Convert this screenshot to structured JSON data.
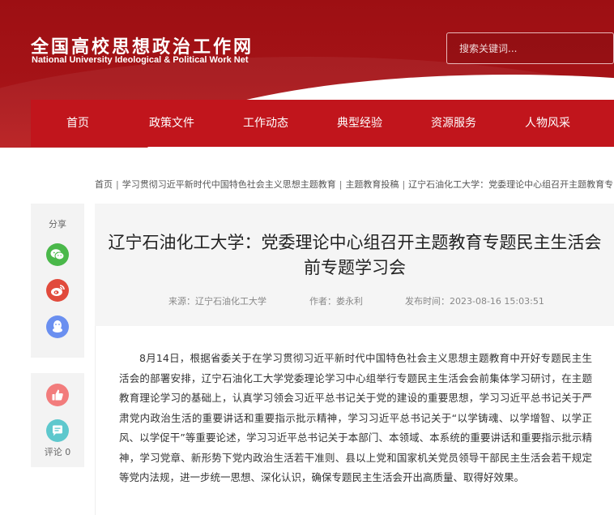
{
  "site": {
    "logo_cn": "全国高校思想政治工作网",
    "logo_en": "National University Ideological & Political Work Net"
  },
  "search": {
    "placeholder": "搜索关键词..."
  },
  "nav": {
    "items": [
      "首页",
      "政策文件",
      "工作动态",
      "典型经验",
      "资源服务",
      "人物风采"
    ]
  },
  "breadcrumb": {
    "items": [
      "首页",
      "学习贯彻习近平新时代中国特色社会主义思想主题教育",
      "主题教育投稿",
      "辽宁石油化工大学：党委理论中心组召开主题教育专"
    ]
  },
  "share": {
    "title": "分享",
    "icons": [
      "wechat-icon",
      "weibo-icon",
      "qq-icon"
    ]
  },
  "actions": {
    "comment_label": "评论 0"
  },
  "article": {
    "title": "辽宁石油化工大学：党委理论中心组召开主题教育专题民主生活会前专题学习会",
    "source": "来源：辽宁石油化工大学",
    "author": "作者：娄永利",
    "time": "发布时间：2023-08-16 15:03:51",
    "paragraph": "8月14日，根据省委关于在学习贯彻习近平新时代中国特色社会主义思想主题教育中开好专题民主生活会的部署安排，辽宁石油化工大学党委理论学习中心组举行专题民主生活会会前集体学习研讨，在主题教育理论学习的基础上，认真学习领会习近平总书记关于党的建设的重要思想，学习习近平总书记关于严肃党内政治生活的重要讲话和重要指示批示精神，学习习近平总书记关于“以学铸魂、以学增智、以学正风、以学促干”等重要论述，学习习近平总书记关于本部门、本领域、本系统的重要讲话和重要指示批示精神，学习党章、新形势下党内政治生活若干准则、县以上党和国家机关党员领导干部民主生活会若干规定等党内法规，进一步统一思想、深化认识，确保专题民主生活会开出高质量、取得好效果。"
  },
  "colors": {
    "brand_red": "#c1151c",
    "header_red": "#a51317"
  }
}
